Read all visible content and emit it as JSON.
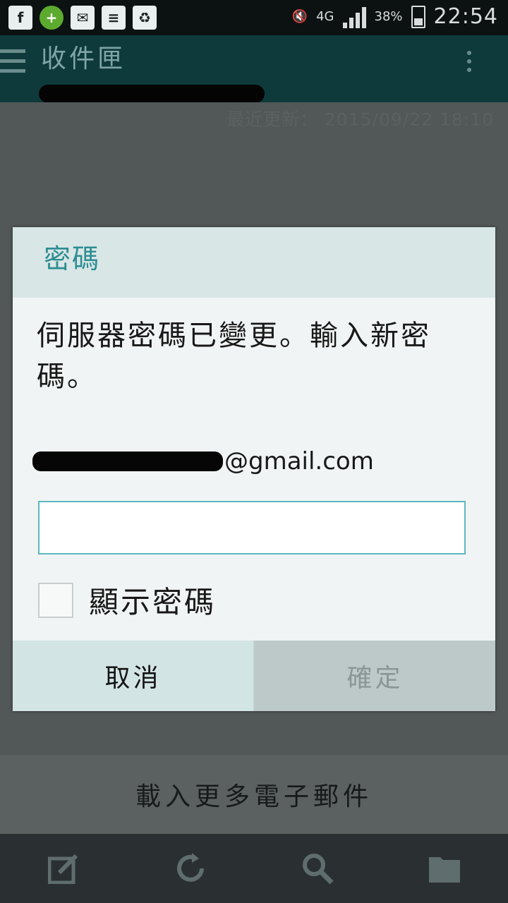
{
  "status_bar": {
    "icons": [
      "facebook-icon",
      "plus-circle-icon",
      "mail-icon",
      "database-icon",
      "recycle-icon"
    ],
    "network": "4G",
    "battery": "38%",
    "time": "22:54"
  },
  "app_bar": {
    "title": "收件匣"
  },
  "inbox": {
    "last_updated": "最近更新： 2015/09/22 18:10",
    "load_more": "載入更多電子郵件"
  },
  "dialog": {
    "title": "密碼",
    "message": "伺服器密碼已變更。輸入新密碼。",
    "email_domain": "@gmail.com",
    "password_value": "",
    "show_password_label": "顯示密碼",
    "show_password_checked": false,
    "cancel_label": "取消",
    "ok_label": "確定"
  },
  "colors": {
    "accent": "#2c8d92",
    "input_border": "#5bb8c1",
    "app_bar": "#0f3a3b"
  }
}
